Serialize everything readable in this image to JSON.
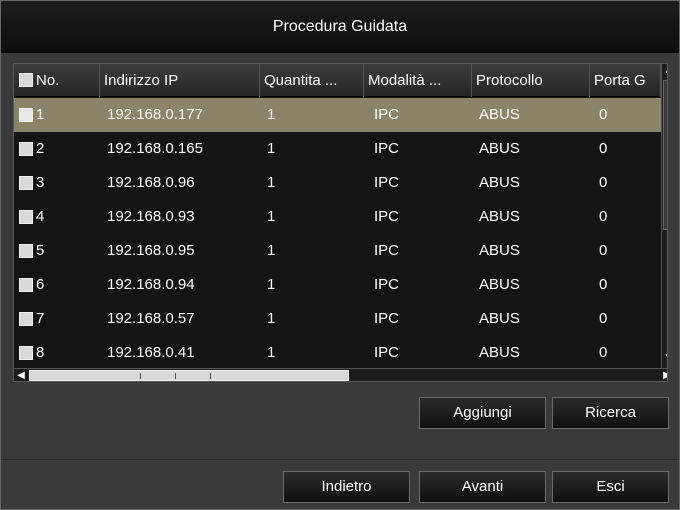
{
  "dialog": {
    "title": "Procedura Guidata"
  },
  "table": {
    "columns": [
      "No.",
      "Indirizzo IP",
      "Quantita ...",
      "Modalità ...",
      "Protocollo",
      "Porta G"
    ],
    "rows": [
      {
        "no": "1",
        "ip": "192.168.0.177",
        "qty": "1",
        "mode": "IPC",
        "protocol": "ABUS",
        "port": "0",
        "selected": true
      },
      {
        "no": "2",
        "ip": "192.168.0.165",
        "qty": "1",
        "mode": "IPC",
        "protocol": "ABUS",
        "port": "0"
      },
      {
        "no": "3",
        "ip": "192.168.0.96",
        "qty": "1",
        "mode": "IPC",
        "protocol": "ABUS",
        "port": "0"
      },
      {
        "no": "4",
        "ip": "192.168.0.93",
        "qty": "1",
        "mode": "IPC",
        "protocol": "ABUS",
        "port": "0"
      },
      {
        "no": "5",
        "ip": "192.168.0.95",
        "qty": "1",
        "mode": "IPC",
        "protocol": "ABUS",
        "port": "0"
      },
      {
        "no": "6",
        "ip": "192.168.0.94",
        "qty": "1",
        "mode": "IPC",
        "protocol": "ABUS",
        "port": "0"
      },
      {
        "no": "7",
        "ip": "192.168.0.57",
        "qty": "1",
        "mode": "IPC",
        "protocol": "ABUS",
        "port": "0"
      },
      {
        "no": "8",
        "ip": "192.168.0.41",
        "qty": "1",
        "mode": "IPC",
        "protocol": "ABUS",
        "port": "0"
      }
    ]
  },
  "actions": {
    "add": "Aggiungi",
    "search": "Ricerca"
  },
  "footer": {
    "back": "Indietro",
    "next": "Avanti",
    "exit": "Esci"
  },
  "colors": {
    "selected_row": "#8b8468",
    "title_bg": "#141414",
    "dialog_bg": "#3a3a3a"
  }
}
